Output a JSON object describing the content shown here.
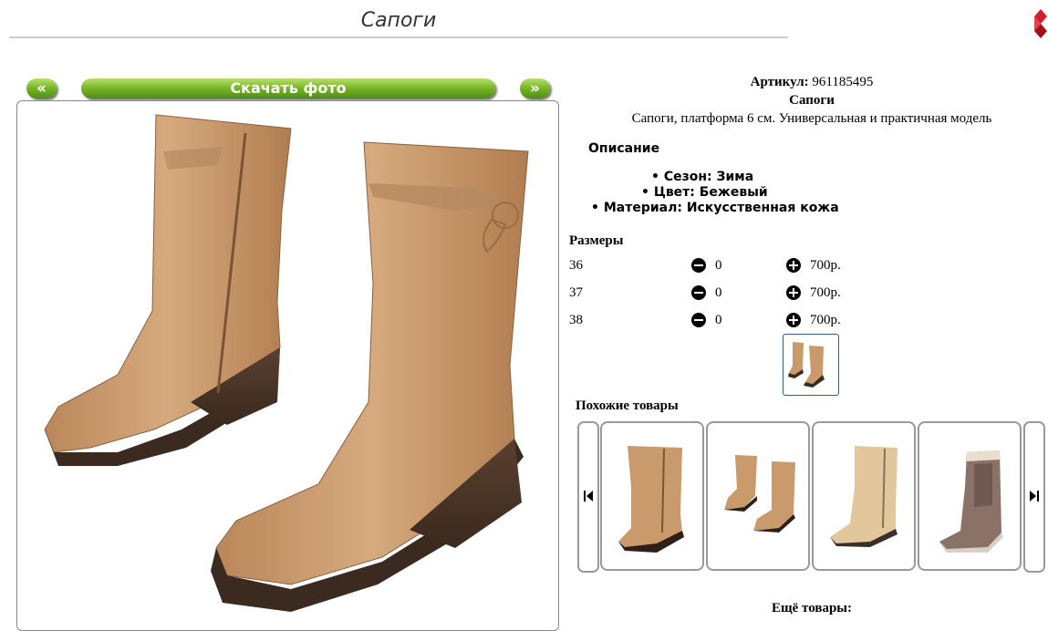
{
  "page": {
    "title": "Сапоги"
  },
  "photo_nav": {
    "prev_label": "«",
    "download_label": "Скачать фото",
    "next_label": "»"
  },
  "product": {
    "article_label": "Артикул:",
    "article_value": "961185495",
    "name": "Сапоги",
    "short_description": "Сапоги, платформа 6 см. Универсальная и практичная модель",
    "description_heading": "Описание",
    "specs": [
      "Сезон: Зима",
      "Цвет: Бежевый",
      "Материал: Искусственная кожа"
    ],
    "sizes_heading": "Размеры",
    "sizes": [
      {
        "size": "36",
        "qty": "0",
        "price": "700р."
      },
      {
        "size": "37",
        "qty": "0",
        "price": "700р."
      },
      {
        "size": "38",
        "qty": "0",
        "price": "700р."
      }
    ]
  },
  "similar": {
    "heading": "Похожие товары",
    "prev_icon": "skip-back-icon",
    "next_icon": "skip-forward-icon"
  },
  "more": {
    "heading": "Ещё товары:"
  },
  "colors": {
    "accent_green": "#7cb82a",
    "boot_tan": "#c99a6b",
    "sole_dark": "#3b2a20"
  }
}
